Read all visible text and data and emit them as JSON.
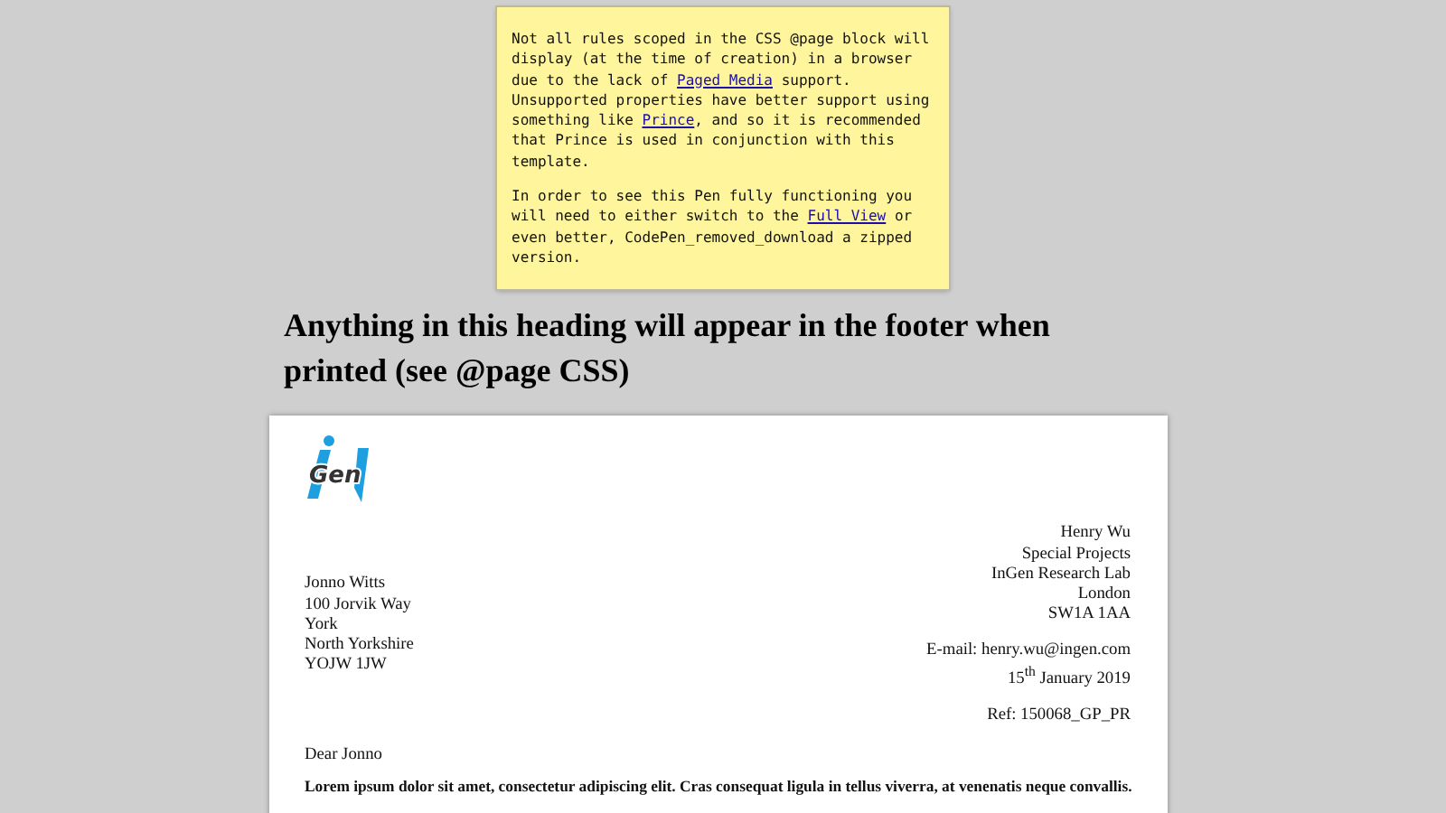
{
  "note": {
    "paragraphs": [
      [
        {
          "kind": "text",
          "text": "Not all rules scoped in the CSS @page block will display (at the time of creation) in a browser due to the lack of "
        },
        {
          "kind": "link",
          "text": "Paged Media"
        },
        {
          "kind": "text",
          "text": " support. Unsupported properties have better support using something like "
        },
        {
          "kind": "link",
          "text": "Prince"
        },
        {
          "kind": "text",
          "text": ", and so it is recommended that Prince is used in conjunction with this template."
        }
      ],
      [
        {
          "kind": "text",
          "text": "In order to see this Pen fully functioning you will need to either switch to the "
        },
        {
          "kind": "link",
          "text": "Full View"
        },
        {
          "kind": "text",
          "text": " or even better, CodePen_removed_download a zipped version."
        }
      ]
    ]
  },
  "heading": "Anything in this heading will appear in the footer when printed (see @page CSS)",
  "letter": {
    "logo_text": "Gen",
    "sender": [
      "Henry Wu",
      "Special Projects",
      "InGen Research Lab",
      "London",
      "SW1A 1AA"
    ],
    "recipient": [
      "Jonno Witts",
      "100 Jorvik Way",
      "York",
      "North Yorkshire",
      "YOJW 1JW"
    ],
    "email": "E-mail: henry.wu@ingen.com",
    "date": "15$^{th}$ January 2019",
    "ref": "Ref: 150068_GP_PR",
    "salutation": "Dear Jonno",
    "body": "Lorem ipsum dolor sit amet, consectetur adipiscing elit. Cras consequat ligula in tellus viverra, at venenatis neque convallis."
  }
}
